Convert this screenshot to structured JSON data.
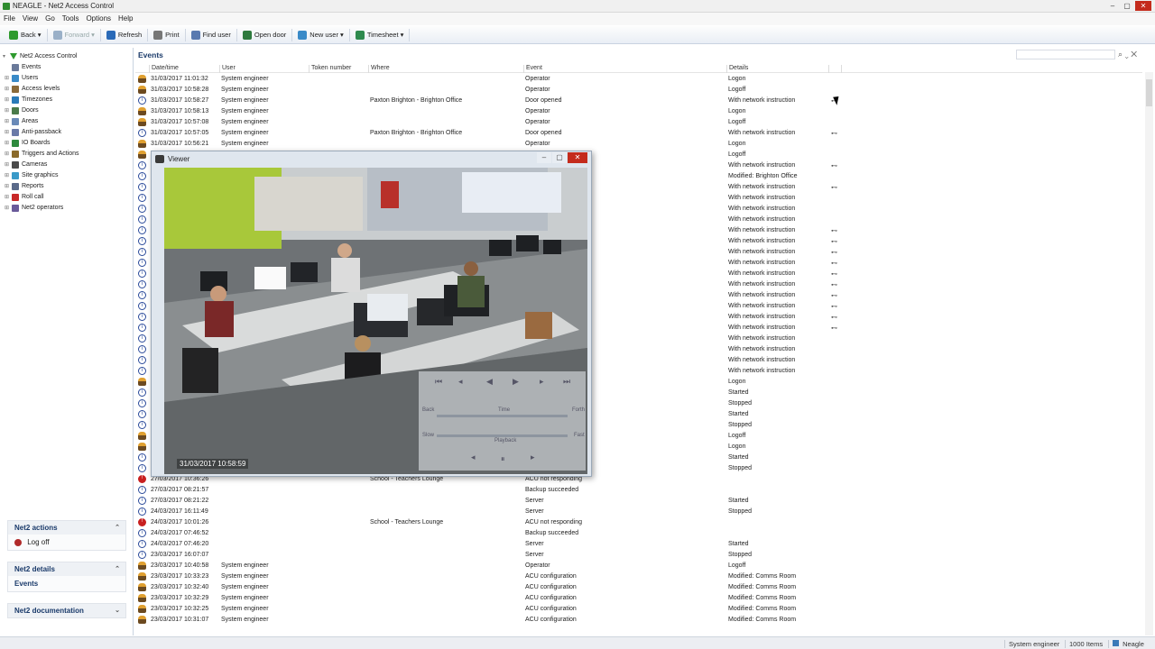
{
  "window": {
    "title": "NEAGLE - Net2 Access Control"
  },
  "menu": [
    "File",
    "View",
    "Go",
    "Tools",
    "Options",
    "Help"
  ],
  "toolbar": [
    {
      "label": "Back ▾",
      "icon": "back-arrow-icon",
      "color": "#2e9a2e",
      "enabled": true
    },
    {
      "label": "Forward ▾",
      "icon": "forward-arrow-icon",
      "color": "#9ab0c8",
      "enabled": false
    },
    {
      "label": "Refresh",
      "icon": "refresh-icon",
      "color": "#2a6ab8",
      "enabled": true
    },
    {
      "label": "Print",
      "icon": "printer-icon",
      "color": "#777777",
      "enabled": true
    },
    {
      "label": "Find user",
      "icon": "find-user-icon",
      "color": "#5a7ab0",
      "enabled": true
    },
    {
      "label": "Open door",
      "icon": "door-icon",
      "color": "#2e7a3e",
      "enabled": true
    },
    {
      "label": "New user ▾",
      "icon": "new-user-icon",
      "color": "#3a8ac8",
      "enabled": true
    },
    {
      "label": "Timesheet ▾",
      "icon": "clock-icon",
      "color": "#2e8a4e",
      "enabled": true
    }
  ],
  "tree": [
    {
      "label": "Net2 Access Control",
      "icon": "net2-root-icon",
      "color": "#2e9a2e",
      "level": 0
    },
    {
      "label": "Events",
      "icon": "events-icon",
      "color": "#6a7a9a",
      "level": 1
    },
    {
      "label": "Users",
      "icon": "users-icon",
      "color": "#3a8ac8",
      "level": 1
    },
    {
      "label": "Access levels",
      "icon": "access-levels-icon",
      "color": "#8a6a3a",
      "level": 1
    },
    {
      "label": "Timezones",
      "icon": "timezones-icon",
      "color": "#2a7ab8",
      "level": 1
    },
    {
      "label": "Doors",
      "icon": "doors-icon",
      "color": "#4a7a4a",
      "level": 1
    },
    {
      "label": "Areas",
      "icon": "areas-icon",
      "color": "#6a8ab8",
      "level": 1
    },
    {
      "label": "Anti-passback",
      "icon": "anti-passback-icon",
      "color": "#6a7aa8",
      "level": 1
    },
    {
      "label": "IO Boards",
      "icon": "io-boards-icon",
      "color": "#2e8a3e",
      "level": 1
    },
    {
      "label": "Triggers and Actions",
      "icon": "triggers-icon",
      "color": "#8a6a2a",
      "level": 1
    },
    {
      "label": "Cameras",
      "icon": "cameras-icon",
      "color": "#4a4a4a",
      "level": 1
    },
    {
      "label": "Site graphics",
      "icon": "site-graphics-icon",
      "color": "#3a9ac8",
      "level": 1
    },
    {
      "label": "Reports",
      "icon": "reports-icon",
      "color": "#5a6a8a",
      "level": 1
    },
    {
      "label": "Roll call",
      "icon": "roll-call-icon",
      "color": "#c82828",
      "level": 1
    },
    {
      "label": "Net2 operators",
      "icon": "operators-icon",
      "color": "#6a5a9a",
      "level": 1
    }
  ],
  "panels": {
    "actions": {
      "title": "Net2 actions",
      "item": "Log off"
    },
    "details": {
      "title": "Net2 details",
      "item": "Events"
    },
    "documentation": {
      "title": "Net2 documentation"
    }
  },
  "events": {
    "title": "Events",
    "columns": [
      "Date/time",
      "User",
      "Token number",
      "Where",
      "Event",
      "Details"
    ],
    "rows_top": [
      {
        "icon": "user",
        "date": "31/03/2017 11:01:32",
        "user": "System engineer",
        "where": "",
        "event": "Operator",
        "details": "Logon",
        "cam": false
      },
      {
        "icon": "user",
        "date": "31/03/2017 10:58:28",
        "user": "System engineer",
        "where": "",
        "event": "Operator",
        "details": "Logoff",
        "cam": false
      },
      {
        "icon": "info",
        "date": "31/03/2017 10:58:27",
        "user": "System engineer",
        "where": "Paxton Brighton - Brighton Office",
        "event": "Door opened",
        "details": "With network instruction",
        "cam": true
      },
      {
        "icon": "user",
        "date": "31/03/2017 10:58:13",
        "user": "System engineer",
        "where": "",
        "event": "Operator",
        "details": "Logon",
        "cam": false
      },
      {
        "icon": "user",
        "date": "31/03/2017 10:57:08",
        "user": "System engineer",
        "where": "",
        "event": "Operator",
        "details": "Logoff",
        "cam": false
      },
      {
        "icon": "info",
        "date": "31/03/2017 10:57:05",
        "user": "System engineer",
        "where": "Paxton Brighton - Brighton Office",
        "event": "Door opened",
        "details": "With network instruction",
        "cam": true
      },
      {
        "icon": "user",
        "date": "31/03/2017 10:56:21",
        "user": "System engineer",
        "where": "",
        "event": "Operator",
        "details": "Logon",
        "cam": false
      }
    ],
    "rows_behind": [
      {
        "icon": "user",
        "details": "Logoff",
        "cam": false
      },
      {
        "icon": "info",
        "details": "With network instruction",
        "cam": true
      },
      {
        "icon": "info",
        "details": "Modified: Brighton Office",
        "cam": false
      },
      {
        "icon": "info",
        "details": "With network instruction",
        "cam": true
      },
      {
        "icon": "info",
        "details": "With network instruction",
        "cam": false
      },
      {
        "icon": "info",
        "details": "With network instruction",
        "cam": false
      },
      {
        "icon": "info",
        "details": "With network instruction",
        "cam": false
      },
      {
        "icon": "info",
        "details": "With network instruction",
        "cam": true
      },
      {
        "icon": "info",
        "details": "With network instruction",
        "cam": true
      },
      {
        "icon": "info",
        "details": "With network instruction",
        "cam": true
      },
      {
        "icon": "info",
        "details": "With network instruction",
        "cam": true
      },
      {
        "icon": "info",
        "details": "With network instruction",
        "cam": true
      },
      {
        "icon": "info",
        "details": "With network instruction",
        "cam": true
      },
      {
        "icon": "info",
        "details": "With network instruction",
        "cam": true
      },
      {
        "icon": "info",
        "details": "With network instruction",
        "cam": true
      },
      {
        "icon": "info",
        "details": "With network instruction",
        "cam": true
      },
      {
        "icon": "info",
        "details": "With network instruction",
        "cam": true
      },
      {
        "icon": "info",
        "details": "With network instruction",
        "cam": false
      },
      {
        "icon": "info",
        "details": "With network instruction",
        "cam": false
      },
      {
        "icon": "info",
        "details": "With network instruction",
        "cam": false
      },
      {
        "icon": "info",
        "details": "With network instruction",
        "cam": false
      },
      {
        "icon": "user",
        "details": "Logon",
        "cam": false
      },
      {
        "icon": "info",
        "details": "Started",
        "cam": false
      },
      {
        "icon": "info",
        "details": "Stopped",
        "cam": false
      },
      {
        "icon": "info",
        "details": "Started",
        "cam": false
      },
      {
        "icon": "info",
        "details": "Stopped",
        "cam": false
      },
      {
        "icon": "user",
        "details": "Logoff",
        "cam": false
      },
      {
        "icon": "user",
        "details": "Logon",
        "cam": false
      },
      {
        "icon": "info",
        "details": "Started",
        "cam": false
      },
      {
        "icon": "info",
        "details": "Stopped",
        "cam": false
      }
    ],
    "rows_bottom": [
      {
        "icon": "err",
        "date": "27/03/2017 10:36:26",
        "user": "",
        "where": "School - Teachers Lounge",
        "event": "ACU not responding",
        "details": ""
      },
      {
        "icon": "info",
        "date": "27/03/2017 08:21:57",
        "user": "",
        "where": "",
        "event": "Backup succeeded",
        "details": ""
      },
      {
        "icon": "info",
        "date": "27/03/2017 08:21:22",
        "user": "",
        "where": "",
        "event": "Server",
        "details": "Started"
      },
      {
        "icon": "info",
        "date": "24/03/2017 16:11:49",
        "user": "",
        "where": "",
        "event": "Server",
        "details": "Stopped"
      },
      {
        "icon": "err",
        "date": "24/03/2017 10:01:26",
        "user": "",
        "where": "School - Teachers Lounge",
        "event": "ACU not responding",
        "details": ""
      },
      {
        "icon": "info",
        "date": "24/03/2017 07:46:52",
        "user": "",
        "where": "",
        "event": "Backup succeeded",
        "details": ""
      },
      {
        "icon": "info",
        "date": "24/03/2017 07:46:20",
        "user": "",
        "where": "",
        "event": "Server",
        "details": "Started"
      },
      {
        "icon": "info",
        "date": "23/03/2017 16:07:07",
        "user": "",
        "where": "",
        "event": "Server",
        "details": "Stopped"
      },
      {
        "icon": "user",
        "date": "23/03/2017 10:40:58",
        "user": "System engineer",
        "where": "",
        "event": "Operator",
        "details": "Logoff"
      },
      {
        "icon": "user",
        "date": "23/03/2017 10:33:23",
        "user": "System engineer",
        "where": "",
        "event": "ACU configuration",
        "details": "Modified: Comms Room"
      },
      {
        "icon": "user",
        "date": "23/03/2017 10:32:40",
        "user": "System engineer",
        "where": "",
        "event": "ACU configuration",
        "details": "Modified: Comms Room"
      },
      {
        "icon": "user",
        "date": "23/03/2017 10:32:29",
        "user": "System engineer",
        "where": "",
        "event": "ACU configuration",
        "details": "Modified: Comms Room"
      },
      {
        "icon": "user",
        "date": "23/03/2017 10:32:25",
        "user": "System engineer",
        "where": "",
        "event": "ACU configuration",
        "details": "Modified: Comms Room"
      },
      {
        "icon": "user",
        "date": "23/03/2017 10:31:07",
        "user": "System engineer",
        "where": "",
        "event": "ACU configuration",
        "details": "Modified: Comms Room"
      }
    ]
  },
  "viewer": {
    "title": "Viewer",
    "timestamp": "31/03/2017 10:58:59",
    "playback_labels": {
      "back": "Back",
      "time": "Time",
      "forth": "Forth",
      "slow": "Slow",
      "playback": "Playback",
      "fast": "Fast"
    }
  },
  "status": {
    "operator": "System engineer",
    "items": "1000 Items",
    "server": "Neagle"
  }
}
